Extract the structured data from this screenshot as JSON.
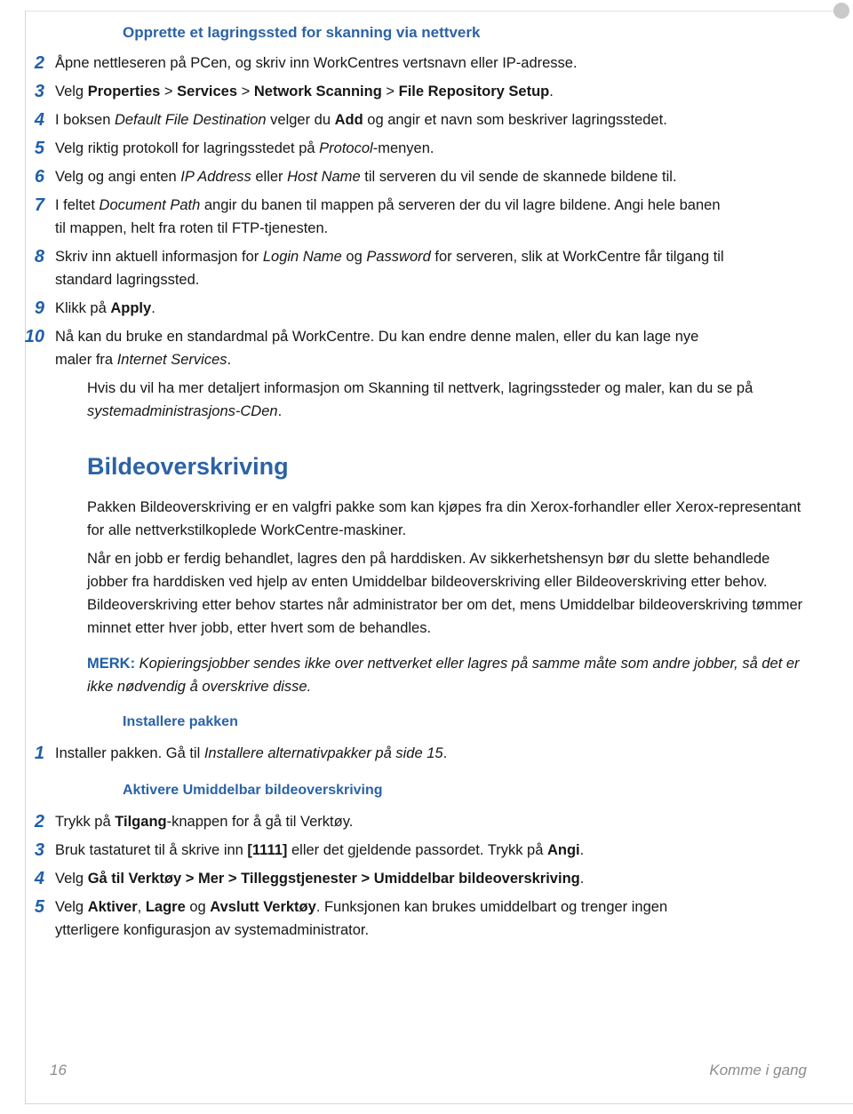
{
  "document": {
    "section_heading": "Opprette et lagringssted for skanning via nettverk",
    "chapter_heading": "Bildeoverskriving",
    "sub_heading_install": "Installere pakken",
    "sub_heading_activate": "Aktivere Umiddelbar bildeoverskriving"
  },
  "scan_steps": [
    {
      "num": "2",
      "parts": [
        {
          "t": "Åpne nettleseren på PCen, og skriv inn WorkCentres vertsnavn eller IP-adresse.",
          "s": "n"
        }
      ]
    },
    {
      "num": "3",
      "parts": [
        {
          "t": "Velg ",
          "s": "n"
        },
        {
          "t": "Properties",
          "s": "b"
        },
        {
          "t": " > ",
          "s": "n"
        },
        {
          "t": "Services",
          "s": "b"
        },
        {
          "t": " > ",
          "s": "n"
        },
        {
          "t": "Network Scanning",
          "s": "b"
        },
        {
          "t": " > ",
          "s": "n"
        },
        {
          "t": "File Repository Setup",
          "s": "b"
        },
        {
          "t": ".",
          "s": "n"
        }
      ]
    },
    {
      "num": "4",
      "parts": [
        {
          "t": "I boksen ",
          "s": "n"
        },
        {
          "t": "Default File Destination",
          "s": "i"
        },
        {
          "t": " velger du ",
          "s": "n"
        },
        {
          "t": "Add",
          "s": "b"
        },
        {
          "t": " og angir et navn som beskriver lagringsstedet.",
          "s": "n"
        }
      ]
    },
    {
      "num": "5",
      "parts": [
        {
          "t": "Velg riktig protokoll for lagringsstedet på ",
          "s": "n"
        },
        {
          "t": "Protocol",
          "s": "i"
        },
        {
          "t": "-menyen.",
          "s": "n"
        }
      ]
    },
    {
      "num": "6",
      "parts": [
        {
          "t": "Velg og angi enten ",
          "s": "n"
        },
        {
          "t": "IP Address",
          "s": "i"
        },
        {
          "t": " eller ",
          "s": "n"
        },
        {
          "t": "Host Name",
          "s": "i"
        },
        {
          "t": " til serveren du vil sende de skannede bildene til.",
          "s": "n"
        }
      ]
    },
    {
      "num": "7",
      "parts": [
        {
          "t": "I feltet ",
          "s": "n"
        },
        {
          "t": "Document Path",
          "s": "i"
        },
        {
          "t": " angir du banen til mappen på serveren der du vil lagre bildene. Angi hele banen til mappen, helt fra roten til FTP-tjenesten.",
          "s": "n"
        }
      ]
    },
    {
      "num": "8",
      "parts": [
        {
          "t": "Skriv inn aktuell informasjon for ",
          "s": "n"
        },
        {
          "t": "Login Name",
          "s": "i"
        },
        {
          "t": " og ",
          "s": "n"
        },
        {
          "t": "Password",
          "s": "i"
        },
        {
          "t": " for serveren, slik at WorkCentre får tilgang til standard lagringssted.",
          "s": "n"
        }
      ]
    },
    {
      "num": "9",
      "parts": [
        {
          "t": "Klikk på ",
          "s": "n"
        },
        {
          "t": "Apply",
          "s": "b"
        },
        {
          "t": ".",
          "s": "n"
        }
      ]
    },
    {
      "num": "10",
      "parts": [
        {
          "t": "Nå kan du bruke en standardmal på WorkCentre. Du kan endre denne malen, eller du kan lage nye maler fra ",
          "s": "n"
        },
        {
          "t": "Internet Services",
          "s": "i"
        },
        {
          "t": ".",
          "s": "n"
        }
      ]
    }
  ],
  "closing_paragraph": {
    "parts": [
      {
        "t": "Hvis du vil ha mer detaljert informasjon om Skanning til nettverk, lagringssteder og maler, kan du se på ",
        "s": "n"
      },
      {
        "t": "systemadministrasjons-CDen",
        "s": "i"
      },
      {
        "t": ".",
        "s": "n"
      }
    ]
  },
  "overwrite_paragraphs": [
    {
      "parts": [
        {
          "t": "Pakken Bildeoverskriving er en valgfri pakke som kan kjøpes fra din Xerox-forhandler eller Xerox-representant for alle nettverkstilkoplede WorkCentre-maskiner.",
          "s": "n"
        }
      ]
    },
    {
      "parts": [
        {
          "t": "Når en jobb er ferdig behandlet, lagres den på harddisken. Av sikkerhetshensyn bør du slette behandlede jobber fra harddisken ved hjelp av enten Umiddelbar bildeoverskriving eller Bildeoverskriving etter behov. Bildeoverskriving etter behov startes når administrator ber om det, mens Umiddelbar bildeoverskriving tømmer minnet etter hver jobb, etter hvert som de behandles.",
          "s": "n"
        }
      ]
    }
  ],
  "note": {
    "label": "MERK:",
    "text": " Kopieringsjobber sendes ikke over nettverket eller lagres på samme måte som andre jobber, så det er ikke nødvendig å overskrive disse."
  },
  "install_steps": [
    {
      "num": "1",
      "parts": [
        {
          "t": "Installer pakken. Gå til ",
          "s": "n"
        },
        {
          "t": "Installere alternativpakker på side 15",
          "s": "i"
        },
        {
          "t": ".",
          "s": "n"
        }
      ]
    }
  ],
  "activate_steps": [
    {
      "num": "2",
      "parts": [
        {
          "t": "Trykk på ",
          "s": "n"
        },
        {
          "t": "Tilgang",
          "s": "b"
        },
        {
          "t": "-knappen for å gå til Verktøy.",
          "s": "n"
        }
      ]
    },
    {
      "num": "3",
      "parts": [
        {
          "t": "Bruk tastaturet til å skrive inn ",
          "s": "n"
        },
        {
          "t": "[1111]",
          "s": "b"
        },
        {
          "t": " eller det gjeldende passordet. Trykk på ",
          "s": "n"
        },
        {
          "t": "Angi",
          "s": "b"
        },
        {
          "t": ".",
          "s": "n"
        }
      ]
    },
    {
      "num": "4",
      "parts": [
        {
          "t": "Velg ",
          "s": "n"
        },
        {
          "t": "Gå til Verktøy > Mer > Tilleggstjenester > Umiddelbar bildeoverskriving",
          "s": "b"
        },
        {
          "t": ".",
          "s": "n"
        }
      ]
    },
    {
      "num": "5",
      "parts": [
        {
          "t": "Velg ",
          "s": "n"
        },
        {
          "t": "Aktiver",
          "s": "b"
        },
        {
          "t": ", ",
          "s": "n"
        },
        {
          "t": "Lagre",
          "s": "b"
        },
        {
          "t": " og ",
          "s": "n"
        },
        {
          "t": "Avslutt Verktøy",
          "s": "b"
        },
        {
          "t": ". Funksjonen kan brukes umiddelbart og trenger ingen ytterligere konfigurasjon av systemadministrator.",
          "s": "n"
        }
      ]
    }
  ],
  "footer": {
    "page_number": "16",
    "title": "Komme i gang"
  },
  "colors": {
    "heading_blue": "#2b62a6",
    "number_blue": "#1f5fa9",
    "body_text": "#171717",
    "footer_grey": "#8c8c8c",
    "rule_grey": "#d6d6d6"
  }
}
